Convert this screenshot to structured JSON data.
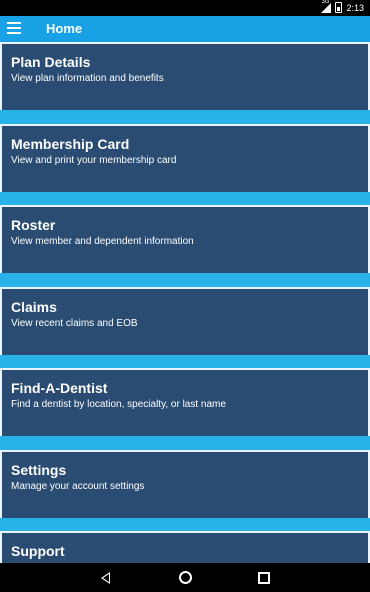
{
  "status_bar": {
    "network": "3G",
    "time": "2:13"
  },
  "app_bar": {
    "title": "Home",
    "menu_icon": "hamburger-menu-icon"
  },
  "menu_items": [
    {
      "title": "Plan Details",
      "subtitle": "View plan information and benefits"
    },
    {
      "title": "Membership Card",
      "subtitle": "View and print your membership card"
    },
    {
      "title": "Roster",
      "subtitle": "View member and dependent information"
    },
    {
      "title": "Claims",
      "subtitle": "View recent claims and EOB"
    },
    {
      "title": "Find-A-Dentist",
      "subtitle": "Find a dentist by location, specialty, or last name"
    },
    {
      "title": "Settings",
      "subtitle": "Manage your account settings"
    },
    {
      "title": "Support",
      "subtitle": ""
    }
  ],
  "colors": {
    "app_bar": "#18a1e5",
    "card": "#2a4b72",
    "background": "#29b2e8"
  },
  "nav_bar": {
    "back_icon": "back-triangle-icon",
    "home_icon": "home-circle-icon",
    "recents_icon": "recents-square-icon"
  }
}
